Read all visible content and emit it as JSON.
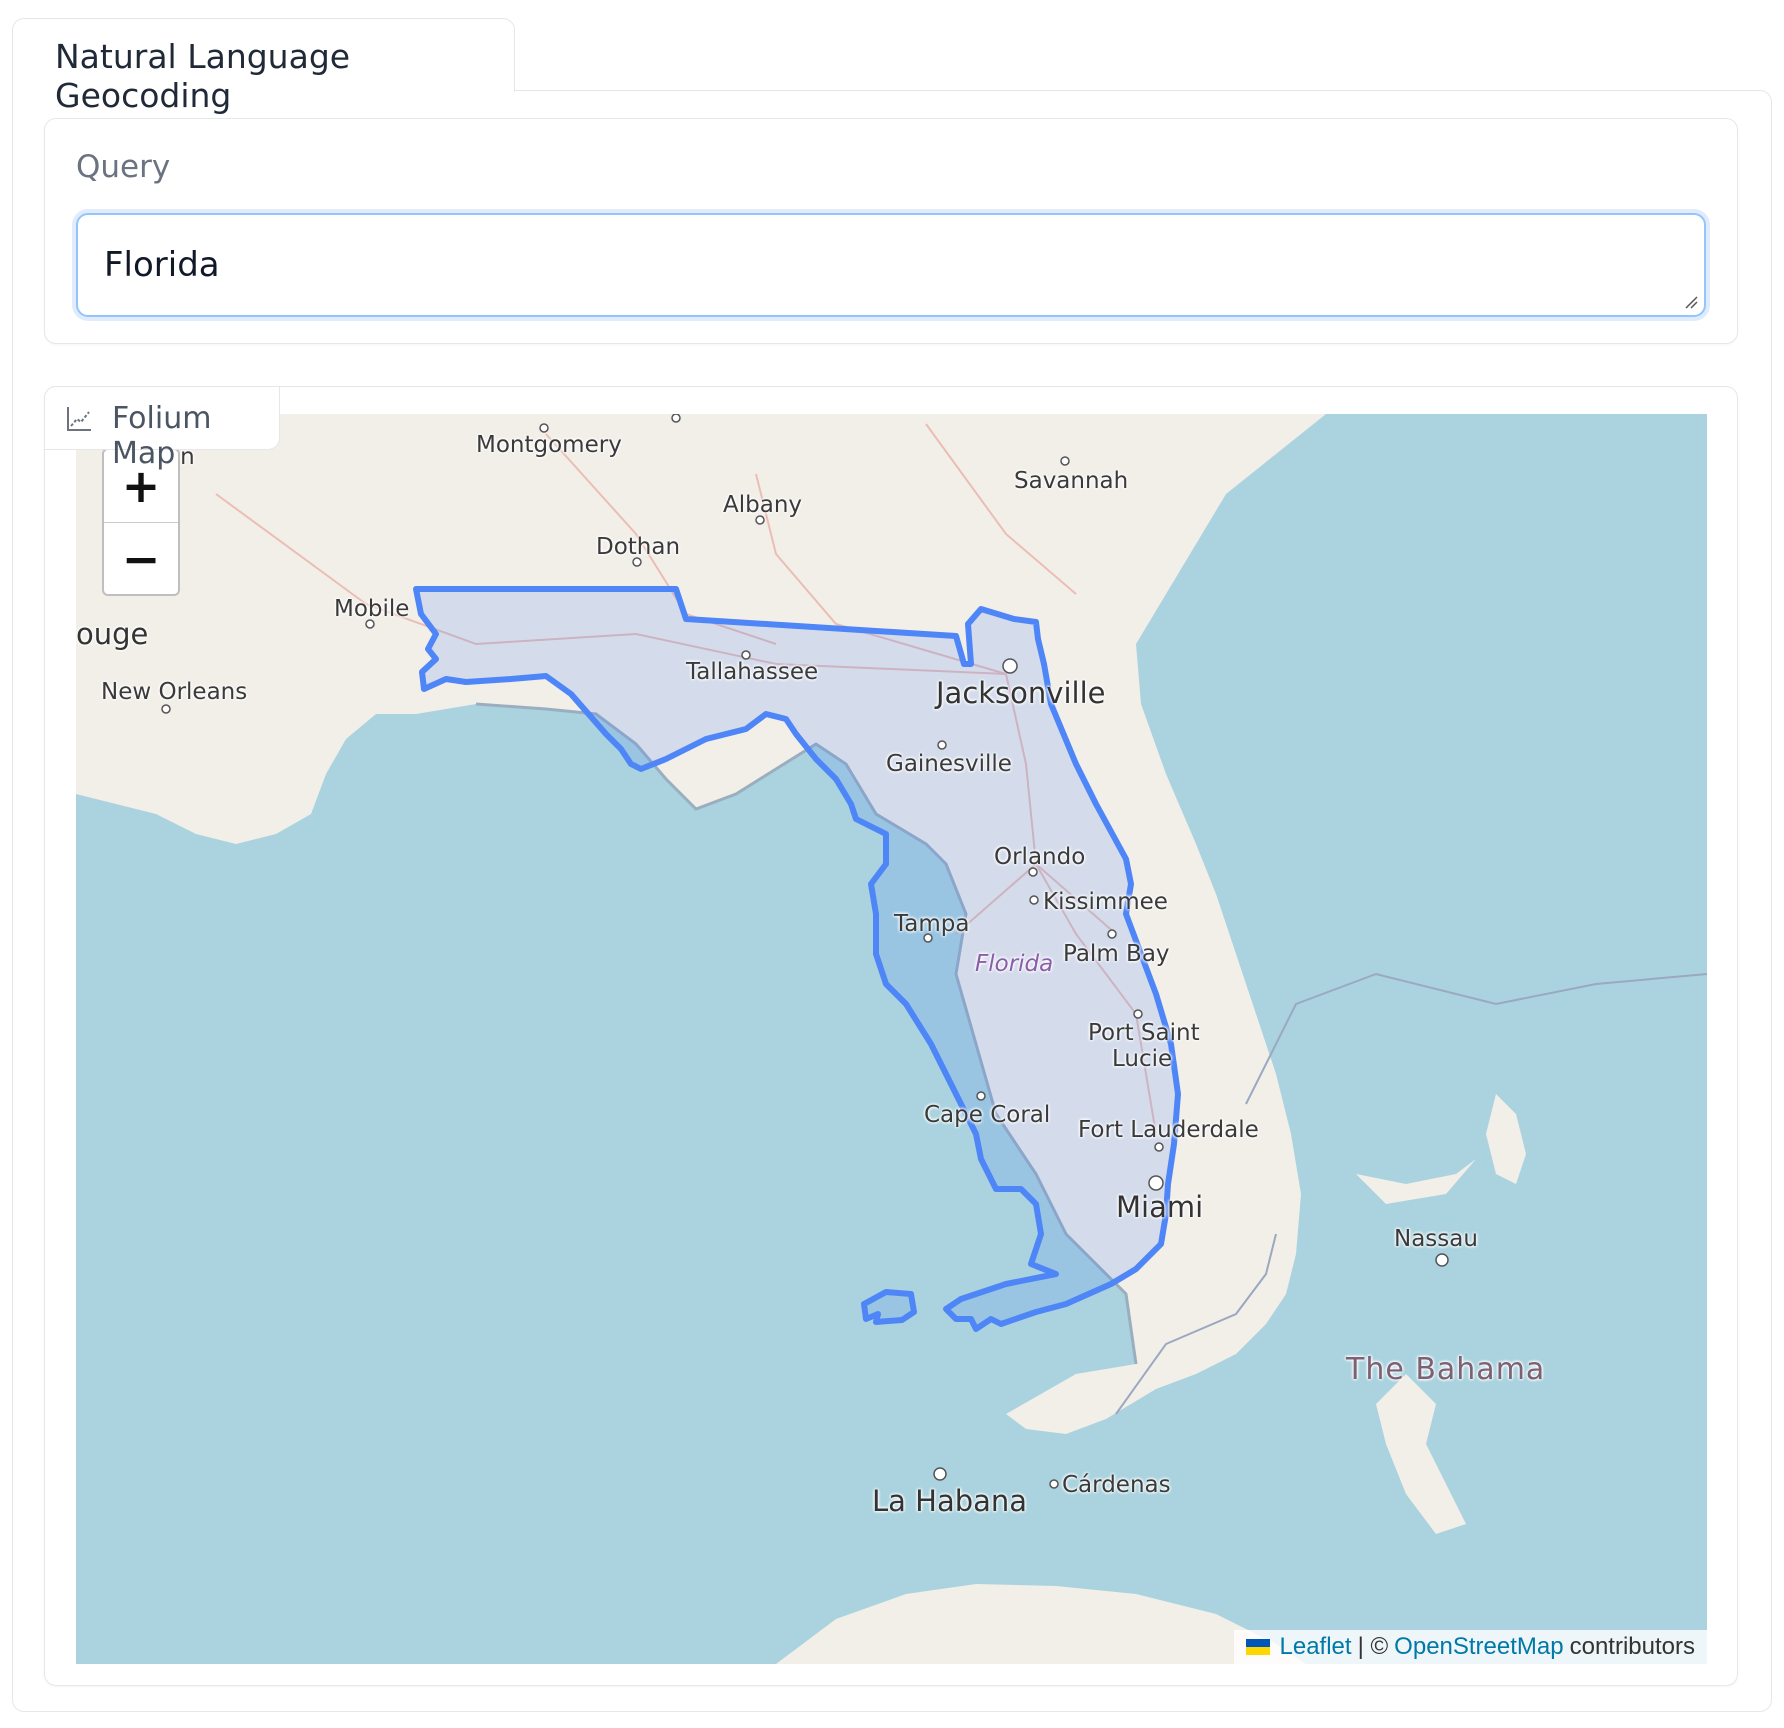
{
  "tab": {
    "label": "Natural Language Geocoding"
  },
  "query": {
    "label": "Query",
    "value": "Florida"
  },
  "map_panel": {
    "label": "Folium Map",
    "zoom_in": "+",
    "zoom_out": "−",
    "attribution": {
      "leaflet": "Leaflet",
      "separator": "| ©",
      "osm": "OpenStreetMap",
      "contributors": "contributors"
    },
    "places": {
      "montgomery": "Montgomery",
      "savannah": "Savannah",
      "albany": "Albany",
      "dothan": "Dothan",
      "mobile": "Mobile",
      "baton_rouge": "ouge",
      "on_fragment": "on",
      "new_orleans": "New Orleans",
      "tallahassee": "Tallahassee",
      "jacksonville": "Jacksonville",
      "gainesville": "Gainesville",
      "orlando": "Orlando",
      "kissimmee": "Kissimmee",
      "tampa": "Tampa",
      "florida": "Florida",
      "palm_bay": "Palm Bay",
      "port_saint_lucie_1": "Port Saint",
      "port_saint_lucie_2": "Lucie",
      "cape_coral": "Cape Coral",
      "fort_lauderdale": "Fort Lauderdale",
      "miami": "Miami",
      "nassau": "Nassau",
      "bahamas": "The Bahama",
      "la_habana": "La Habana",
      "cardenas": "Cárdenas"
    },
    "colors": {
      "ocean": "#aad3df",
      "land": "#f2efe9",
      "outline": "#4f86f7"
    }
  }
}
